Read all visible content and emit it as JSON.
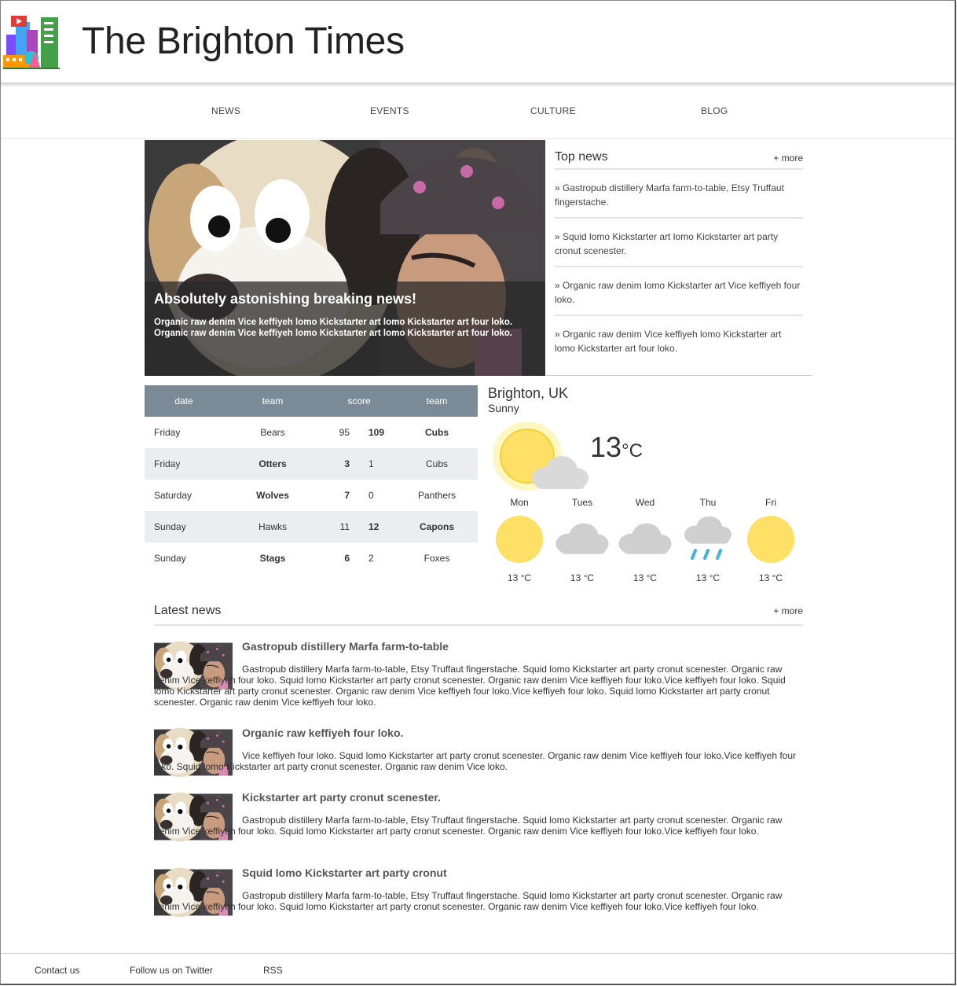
{
  "header": {
    "title": "The Brighton Times"
  },
  "nav": {
    "items": [
      "NEWS",
      "EVENTS",
      "CULTURE",
      "BLOG"
    ]
  },
  "hero": {
    "title": "Absolutely astonishing breaking news!",
    "text": "Organic raw denim Vice keffiyeh lomo Kickstarter art lomo Kickstarter art four loko. Organic raw denim Vice keffiyeh lomo Kickstarter art lomo Kickstarter art four loko."
  },
  "top_news": {
    "title": "Top news",
    "more": "+ more",
    "items": [
      "» Gastropub distillery Marfa farm-to-table, Etsy Truffaut fingerstache.",
      "» Squid lomo Kickstarter art lomo Kickstarter art party cronut scenester.",
      "» Organic raw denim lomo Kickstarter art Vice keffiyeh four loko.",
      "» Organic raw denim Vice keffiyeh lomo Kickstarter art lomo Kickstarter art four loko."
    ]
  },
  "scores": {
    "headers": [
      "date",
      "team",
      "score",
      "team"
    ],
    "rows": [
      {
        "date": "Friday",
        "home": "Bears",
        "home_score": "95",
        "away_score": "109",
        "away": "Cubs",
        "winner": "away"
      },
      {
        "date": "Friday",
        "home": "Otters",
        "home_score": "3",
        "away_score": "1",
        "away": "Cubs",
        "winner": "home"
      },
      {
        "date": "Saturday",
        "home": "Wolves",
        "home_score": "7",
        "away_score": "0",
        "away": "Panthers",
        "winner": "home"
      },
      {
        "date": "Sunday",
        "home": "Hawks",
        "home_score": "11",
        "away_score": "12",
        "away": "Capons",
        "winner": "away"
      },
      {
        "date": "Sunday",
        "home": "Stags",
        "home_score": "6",
        "away_score": "2",
        "away": "Foxes",
        "winner": "home"
      }
    ]
  },
  "weather": {
    "city": "Brighton, UK",
    "condition": "Sunny",
    "temp": "13",
    "unit": "°C",
    "current_icon": "sun-cloud-icon",
    "forecast": [
      {
        "day": "Mon",
        "temp": "13 °C",
        "icon": "sun-icon"
      },
      {
        "day": "Tues",
        "temp": "13 °C",
        "icon": "cloud-icon"
      },
      {
        "day": "Wed",
        "temp": "13 °C",
        "icon": "cloud-icon"
      },
      {
        "day": "Thu",
        "temp": "13 °C",
        "icon": "rain-icon"
      },
      {
        "day": "Fri",
        "temp": "13 °C",
        "icon": "sun-icon"
      }
    ],
    "colors": {
      "sun": "#ffe066",
      "cloud": "#cfcfcf",
      "rain": "#3fb5d8"
    }
  },
  "latest_news": {
    "title": "Latest news",
    "more": "+ more",
    "items": [
      {
        "title": "Gastropub distillery Marfa farm-to-table",
        "text": "Gastropub distillery Marfa farm-to-table, Etsy Truffaut fingerstache. Squid lomo Kickstarter art party cronut scenester. Organic raw denim Vice keffiyeh four loko. Squid lomo Kickstarter art party cronut scenester. Organic raw denim Vice keffiyeh four loko.Vice keffiyeh four loko. Squid lomo Kickstarter art party cronut scenester. Organic raw denim Vice keffiyeh four loko.Vice keffiyeh four loko. Squid lomo Kickstarter art party cronut scenester. Organic raw denim Vice keffiyeh four loko."
      },
      {
        "title": "Organic raw keffiyeh four loko.",
        "text": "Vice keffiyeh four loko. Squid lomo Kickstarter art party cronut scenester. Organic raw denim Vice keffiyeh four loko.Vice keffiyeh four loko. Squid lomo Kickstarter art party cronut scenester. Organic raw denim Vice loko."
      },
      {
        "title": "Kickstarter art party cronut scenester.",
        "text": "Gastropub distillery Marfa farm-to-table, Etsy Truffaut fingerstache. Squid lomo Kickstarter art party cronut scenester. Organic raw denim Vice keffiyeh four loko. Squid lomo Kickstarter art party cronut scenester. Organic raw denim Vice keffiyeh four loko.Vice keffiyeh four loko."
      },
      {
        "title": "Squid lomo Kickstarter art party cronut",
        "text": "Gastropub distillery Marfa farm-to-table, Etsy Truffaut fingerstache. Squid lomo Kickstarter art party cronut scenester. Organic raw denim Vice keffiyeh four loko. Squid lomo Kickstarter art party cronut scenester. Organic raw denim Vice keffiyeh four loko.Vice keffiyeh four loko."
      }
    ]
  },
  "footer": {
    "links": [
      "Contact us",
      "Follow us on Twitter",
      "RSS"
    ]
  }
}
